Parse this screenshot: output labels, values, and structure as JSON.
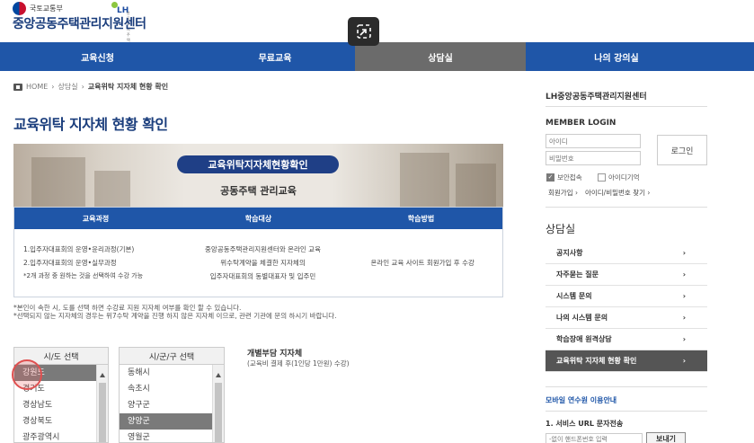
{
  "header": {
    "ministry": "국토교통부",
    "center_name": "중앙공동주택관리지원센터",
    "lh_logo": "LH",
    "lh_sub": "한국토지주택공사"
  },
  "nav": {
    "items": [
      {
        "label": "교육신청",
        "active": false
      },
      {
        "label": "무료교육",
        "active": false
      },
      {
        "label": "상담실",
        "active": true
      },
      {
        "label": "나의 강의실",
        "active": false
      }
    ]
  },
  "breadcrumb": {
    "home": "HOME",
    "sep": "›",
    "parent": "상담실",
    "current": "교육위탁 지자체 현황 확인"
  },
  "page_title": "교육위탁 지자체 현황 확인",
  "banner": {
    "title": "교육위탁지자체현황확인",
    "subtitle": "공동주택 관리교육"
  },
  "info_table": {
    "headers": [
      "교육과정",
      "학습대상",
      "학습방법"
    ],
    "course": {
      "line1": "1.입주자대표회의 운영•윤리과정(기본)",
      "line2": "2.입주자대표회의 운영•실무과정",
      "line3": "*2개 과정 중 원하는 것을 선택하여 수강 가능"
    },
    "target": {
      "line1": "중앙공동주택관리지원센터와 온라인 교육",
      "line2": "위수탁계약을 체결한 지자체의",
      "line3": "입주자대표회의 동별대표자 및 입주민"
    },
    "method": "온라인 교육 사이트 회원가입 후 수강"
  },
  "notes": {
    "line1": "*본인이 속한 시, 도를 선택 하면 수강료 지원 지자체 여부를 확인 할 수 있습니다.",
    "line2": "*선택되지 않는 지자체의 경우는 위7수탁 계약을 진행 하지 않은 지자체 이므로, 관련 기관에 문의 하시기 바랍니다."
  },
  "province_select": {
    "header": "시/도 선택",
    "items": [
      "강원도",
      "경기도",
      "경상남도",
      "경상북도",
      "광주광역시"
    ],
    "selected": "강원도"
  },
  "city_select": {
    "header": "시/군/구 선택",
    "items": [
      "동해시",
      "속초시",
      "양구군",
      "양양군",
      "영월군"
    ],
    "selected": "양양군"
  },
  "burden": {
    "title": "개별부담 지자체",
    "subtitle": "(교육비 결제 후(1인당 1만원) 수강)"
  },
  "sidebar": {
    "org": "LH중앙공동주택관리지원센터",
    "login": {
      "title": "MEMBER LOGIN",
      "id_placeholder": "아이디",
      "pw_placeholder": "비밀번호",
      "button": "로그인",
      "secure_label": "보안접속",
      "remember_label": "아이디기억",
      "join_link": "회원가입 ›",
      "find_link": "아이디/비밀번호 찾기 ›"
    },
    "board_title": "상담실",
    "board_items": [
      {
        "label": "공지사항",
        "active": false
      },
      {
        "label": "자주묻는 질문",
        "active": false
      },
      {
        "label": "시스템 문의",
        "active": false
      },
      {
        "label": "나의 시스템 문의",
        "active": false
      },
      {
        "label": "학습장애 원격상담",
        "active": false
      },
      {
        "label": "교육위탁 지자체 현황 확인",
        "active": true
      }
    ],
    "chevron": "›",
    "mobile_title": "모바일 연수원 이용안내",
    "service_title": "1. 서비스 URL 문자전송",
    "phone_placeholder": "-없이 핸드폰번호 입력",
    "send_button": "보내기"
  },
  "colors": {
    "nav_blue": "#1f56a8",
    "title_navy": "#1a3d7c",
    "active_gray": "#6b6b6b"
  }
}
